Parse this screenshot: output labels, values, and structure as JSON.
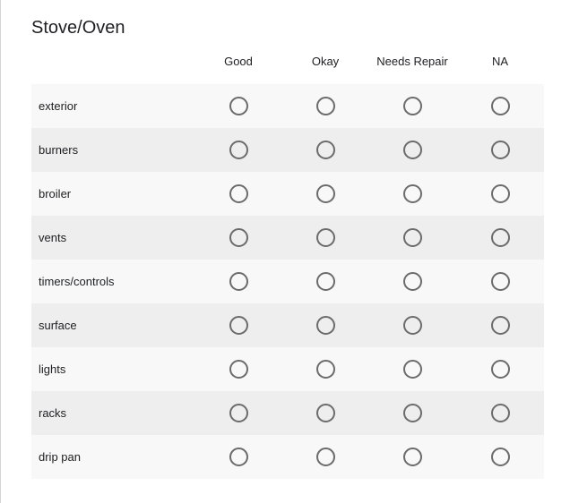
{
  "question": {
    "title": "Stove/Oven"
  },
  "columns": [
    {
      "key": "good",
      "label": "Good"
    },
    {
      "key": "okay",
      "label": "Okay"
    },
    {
      "key": "needs-repair",
      "label": "Needs Repair"
    },
    {
      "key": "na",
      "label": "NA"
    }
  ],
  "rows": [
    {
      "key": "exterior",
      "label": "exterior",
      "selected": null
    },
    {
      "key": "burners",
      "label": "burners",
      "selected": null
    },
    {
      "key": "broiler",
      "label": "broiler",
      "selected": null
    },
    {
      "key": "vents",
      "label": "vents",
      "selected": null
    },
    {
      "key": "timers-controls",
      "label": "timers/controls",
      "selected": null
    },
    {
      "key": "surface",
      "label": "surface",
      "selected": null
    },
    {
      "key": "lights",
      "label": "lights",
      "selected": null
    },
    {
      "key": "racks",
      "label": "racks",
      "selected": null
    },
    {
      "key": "drip-pan",
      "label": "drip pan",
      "selected": null
    }
  ],
  "colors": {
    "row_background": "#f8f8f8",
    "row_background_alt": "#eeeeee",
    "radio_border": "#6b6b6b",
    "text": "#202124"
  }
}
